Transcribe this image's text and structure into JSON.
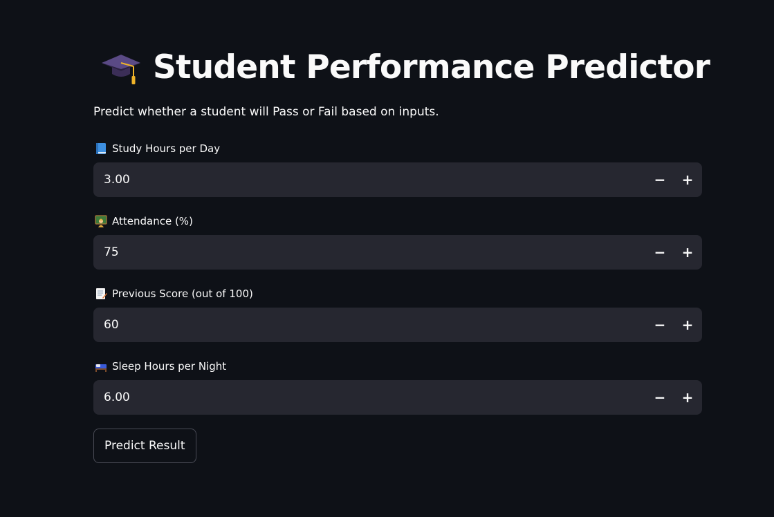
{
  "header": {
    "icon": "graduation-cap-icon",
    "title": "Student Performance Predictor",
    "subtitle": "Predict whether a student will Pass or Fail based on inputs."
  },
  "fields": [
    {
      "icon": "blue-book-icon",
      "label": "Study Hours per Day",
      "value": "3.00"
    },
    {
      "icon": "teacher-icon",
      "label": "Attendance (%)",
      "value": "75"
    },
    {
      "icon": "memo-icon",
      "label": "Previous Score (out of 100)",
      "value": "60"
    },
    {
      "icon": "bed-icon",
      "label": "Sleep Hours per Night",
      "value": "6.00"
    }
  ],
  "stepper": {
    "minus": "−",
    "plus": "+"
  },
  "actions": {
    "predict_label": "Predict Result"
  },
  "colors": {
    "background": "#0e1117",
    "input_background": "#262730",
    "text": "#fafafa",
    "button_border": "#4a4c56"
  }
}
